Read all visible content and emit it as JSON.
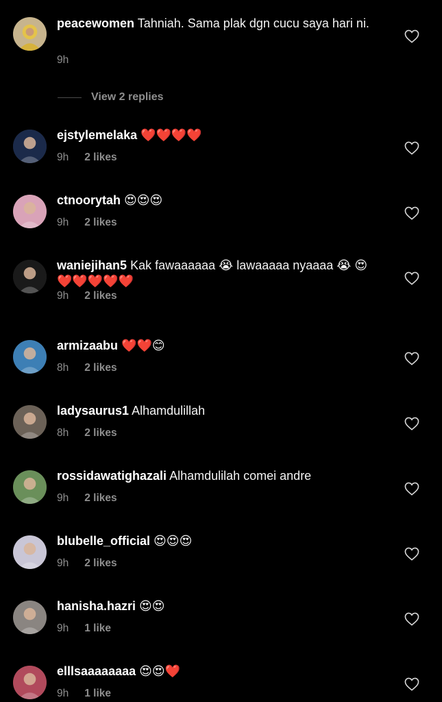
{
  "first_comment": {
    "username": "peacewomen",
    "text": "Tahniah. Sama plak dgn cucu saya hari ni.",
    "time": "9h"
  },
  "view_replies": "View 2 replies",
  "comments": [
    {
      "username": "ejstylemelaka",
      "text": "❤️❤️❤️❤️",
      "time": "9h",
      "likes": "2 likes",
      "avatar_color": "#1b2a4a"
    },
    {
      "username": "ctnoorytah",
      "text": "😍😍😍",
      "time": "9h",
      "likes": "2 likes",
      "avatar_color": "#d9a3b8"
    },
    {
      "username": "waniejihan5",
      "text": "Kak fawaaaaaa 😭 lawaaaaa nyaaaa 😭 😍❤️❤️❤️❤️❤️",
      "time": "9h",
      "likes": "2 likes",
      "avatar_color": "#1a1a1a"
    },
    {
      "username": "armizaabu",
      "text": "❤️❤️😊",
      "time": "8h",
      "likes": "2 likes",
      "avatar_color": "#3d7fb5"
    },
    {
      "username": "ladysaurus1",
      "text": "Alhamdulillah",
      "time": "8h",
      "likes": "2 likes",
      "avatar_color": "#6b6157"
    },
    {
      "username": "rossidawatighazali",
      "text": "Alhamdulilah comei andre",
      "time": "9h",
      "likes": "2 likes",
      "avatar_color": "#6a8f5a"
    },
    {
      "username": "blubelle_official",
      "text": "😍😍😍",
      "time": "9h",
      "likes": "2 likes",
      "avatar_color": "#c9c6d6"
    },
    {
      "username": "hanisha.hazri",
      "text": "😍😍",
      "time": "9h",
      "likes": "1 like",
      "avatar_color": "#8a8581"
    },
    {
      "username": "elllsaaaaaaaa",
      "text": "😍😍❤️",
      "time": "9h",
      "likes": "1 like",
      "avatar_color": "#b14a5c"
    }
  ],
  "icons": {
    "heart": "heart-outline-icon"
  }
}
